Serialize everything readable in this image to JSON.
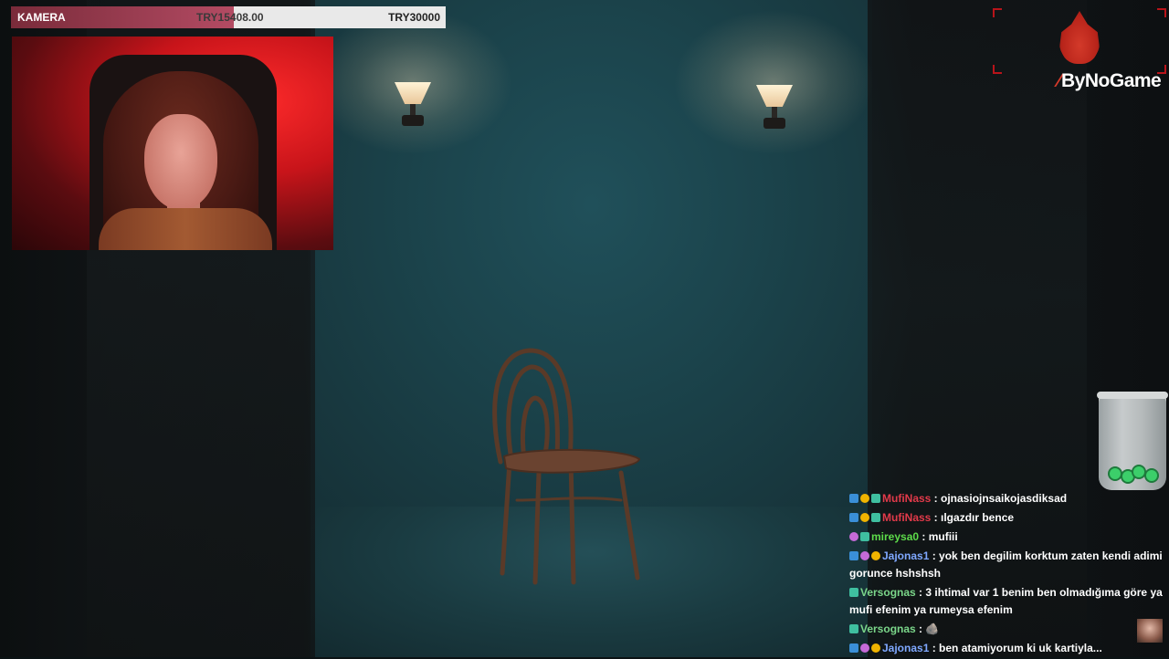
{
  "donation_bar": {
    "label": "KAMERA",
    "current_amount": "TRY15408.00",
    "goal_amount": "TRY30000",
    "progress": 0.5136
  },
  "branding": {
    "logo_name": "flame-logo-icon",
    "brand_text": "ByNoGame",
    "accent_color": "#b8141a"
  },
  "webcam": {
    "description_icon": "webcam-feed"
  },
  "jar": {
    "icon": "tip-jar-icon"
  },
  "chat": {
    "messages": [
      {
        "user": "MufiNass",
        "text": "ojnasiojnsaikojasdiksad",
        "badges": [
          "blue",
          "gold",
          "teal"
        ],
        "color": "red"
      },
      {
        "user": "MufiNass",
        "text": "ılgazdır bence",
        "badges": [
          "blue",
          "gold",
          "teal"
        ],
        "color": "red"
      },
      {
        "user": "mireysa0",
        "text": "mufiii",
        "badges": [
          "pink",
          "teal"
        ],
        "color": "green"
      },
      {
        "user": "Jajonas1",
        "text": "yok ben degilim korktum zaten kendi adimi gorunce hshshsh",
        "badges": [
          "blue",
          "pink",
          "gold"
        ],
        "color": "blue"
      },
      {
        "user": "Versognas",
        "text": "3 ihtimal var 1 benim ben olmadığıma göre ya mufi efenim ya rumeysa efenim",
        "badges": [
          "teal"
        ],
        "color": "teal"
      },
      {
        "user": "Versognas",
        "text": "🪨",
        "badges": [
          "teal"
        ],
        "color": "teal"
      },
      {
        "user": "Jajonas1",
        "text": "ben atamiyorum ki uk kartiyla...",
        "badges": [
          "blue",
          "pink",
          "gold"
        ],
        "color": "blue"
      }
    ]
  }
}
